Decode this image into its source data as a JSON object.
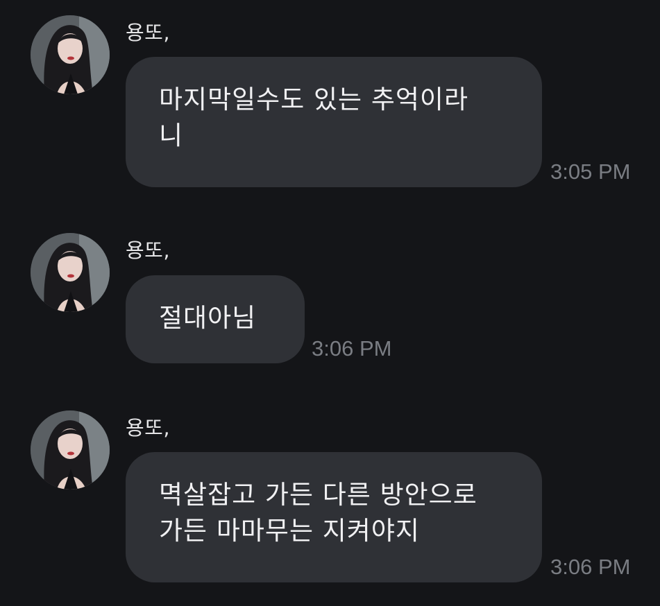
{
  "colors": {
    "background": "#141518",
    "bubble": "#2f3136",
    "message_text": "#f1f1f3",
    "sender_text": "#e6e6e8",
    "timestamp_text": "#7a7d83"
  },
  "messages": [
    {
      "sender": "용또,",
      "avatar_icon": "profile-photo-icon",
      "text": "마지막일수도 있는 추억이라\n니",
      "time": "3:05 PM"
    },
    {
      "sender": "용또,",
      "avatar_icon": "profile-photo-icon",
      "text": "절대아님",
      "time": "3:06 PM"
    },
    {
      "sender": "용또,",
      "avatar_icon": "profile-photo-icon",
      "text": "멱살잡고 가든 다른 방안으로\n가든 마마무는 지켜야지",
      "time": "3:06 PM"
    }
  ]
}
